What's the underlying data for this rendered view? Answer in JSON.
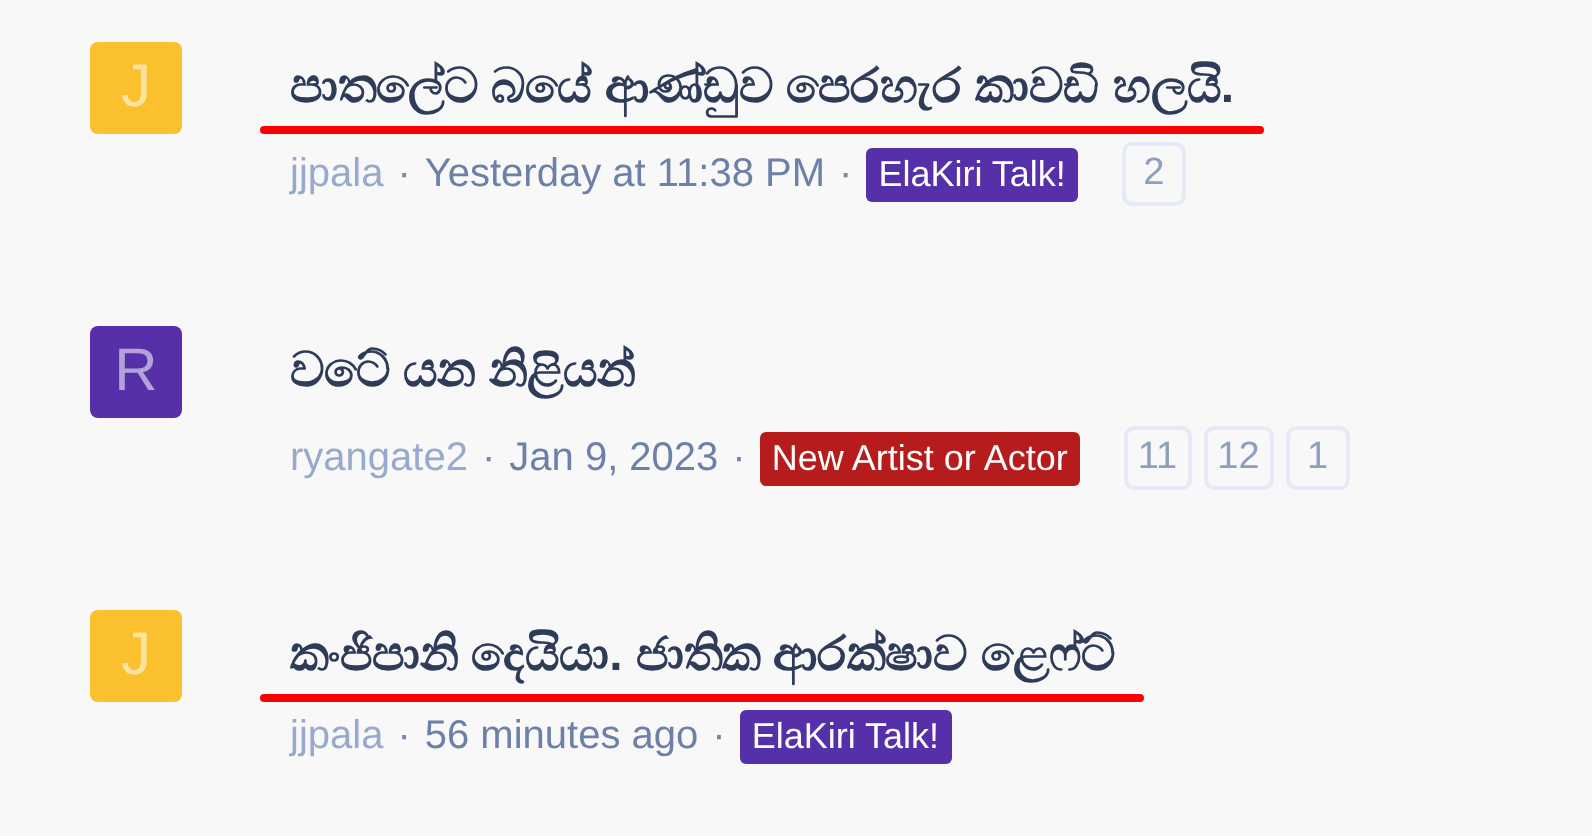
{
  "threads": [
    {
      "avatar": {
        "letter": "J",
        "color": "#fbc02d"
      },
      "title": "පාතලේට බයේ ආණ්ඩුව පෙරහැර කාවඩි හලයි.",
      "underlined": true,
      "author": "jjpala",
      "separators": [
        "·",
        "·"
      ],
      "time": "Yesterday at 11:38 PM",
      "tag": {
        "label": "ElaKiri Talk!",
        "color": "#5530a8"
      },
      "pages": [
        "2"
      ]
    },
    {
      "avatar": {
        "letter": "R",
        "color": "#5530a8"
      },
      "title": "වටේ යන නිළියන්",
      "underlined": false,
      "author": "ryangate2",
      "separators": [
        "·",
        "·"
      ],
      "time": "Jan 9, 2023",
      "tag": {
        "label": "New Artist or Actor",
        "color": "#b71c1c"
      },
      "pages": [
        "11",
        "12",
        "1"
      ]
    },
    {
      "avatar": {
        "letter": "J",
        "color": "#fbc02d"
      },
      "title": "කංජිපානි දෙයියා. ජාතික ආරක්ෂාව ළෙෆ්ට්",
      "underlined": true,
      "author": "jjpala",
      "separators": [
        "·",
        "·"
      ],
      "time": "56 minutes ago",
      "tag": {
        "label": "ElaKiri Talk!",
        "color": "#5530a8"
      }
    }
  ]
}
